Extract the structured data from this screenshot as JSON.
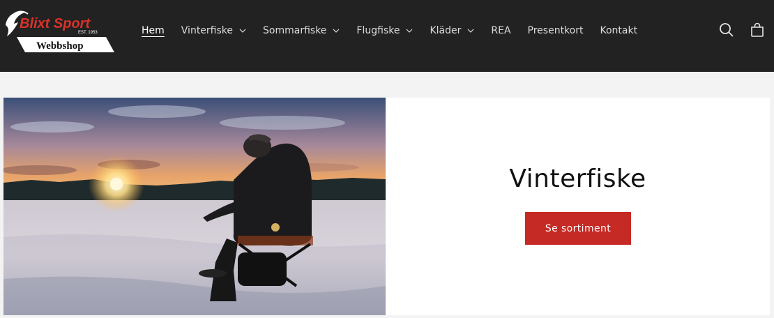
{
  "brand": {
    "name": "Blixt Sport",
    "est": "EST. 1953",
    "sub": "Webbshop"
  },
  "nav": {
    "items": [
      {
        "label": "Hem",
        "active": true,
        "dropdown": false
      },
      {
        "label": "Vinterfiske",
        "active": false,
        "dropdown": true
      },
      {
        "label": "Sommarfiske",
        "active": false,
        "dropdown": true
      },
      {
        "label": "Flugfiske",
        "active": false,
        "dropdown": true
      },
      {
        "label": "Kläder",
        "active": false,
        "dropdown": true
      },
      {
        "label": "REA",
        "active": false,
        "dropdown": false
      },
      {
        "label": "Presentkort",
        "active": false,
        "dropdown": false
      },
      {
        "label": "Kontakt",
        "active": false,
        "dropdown": false
      }
    ]
  },
  "header_icons": [
    "search-icon",
    "cart-icon"
  ],
  "hero": {
    "title": "Vinterfiske",
    "button_label": "Se sortiment"
  },
  "colors": {
    "header_bg": "#222222",
    "accent": "#c62a24",
    "page_bg": "#f3f3f3"
  }
}
